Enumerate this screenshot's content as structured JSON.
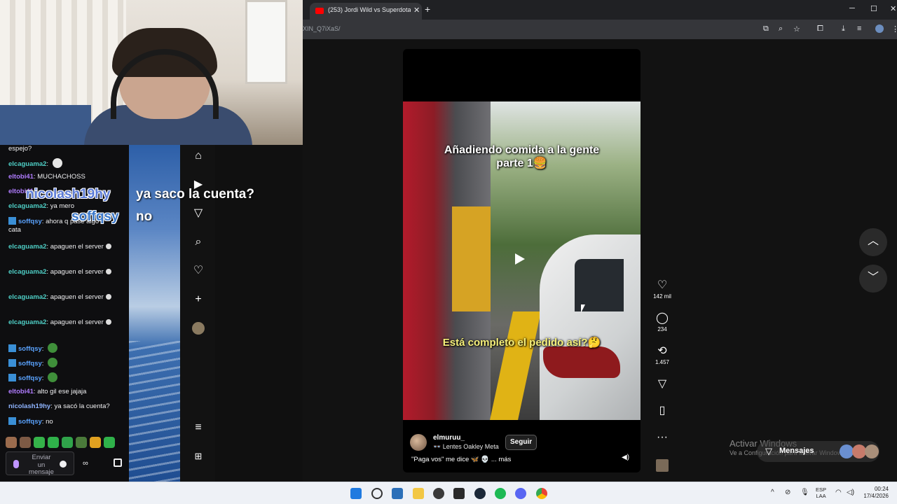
{
  "browser": {
    "tab_title": "(253) Jordi Wild vs Superdotad",
    "tab_close": "✕",
    "new_tab": "+",
    "url": "XIN_Q7iXaS/",
    "window_controls": {
      "minimize": "─",
      "maximize": "☐",
      "close": "✕"
    }
  },
  "chat": {
    "messages": [
      {
        "user": "",
        "text": "espejo?",
        "color": "#efeff1"
      },
      {
        "user": "elcaguama2",
        "text": "",
        "color": "#4ecdc4",
        "emote": "skull"
      },
      {
        "user": "eltobi41",
        "text": "MUCHACHOSS",
        "color": "#b07cff"
      },
      {
        "user": "eltobi41",
        "text": "",
        "color": "#b07cff"
      },
      {
        "user": "elcaguama2",
        "text": "ya mero",
        "color": "#4ecdc4"
      },
      {
        "user": "soffqsy",
        "text": "ahora q pase algo",
        "text2": "cata",
        "color": "#5aa3ff",
        "badge": true
      },
      {
        "user": "elcaguama2",
        "text": "apaguen el server",
        "color": "#4ecdc4"
      },
      {
        "user": "elcaguama2",
        "text": "apaguen el server",
        "color": "#4ecdc4"
      },
      {
        "user": "elcaguama2",
        "text": "apaguen el server",
        "color": "#4ecdc4"
      },
      {
        "user": "elcaguama2",
        "text": "apaguen el server",
        "color": "#4ecdc4"
      },
      {
        "user": "soffqsy",
        "text": "",
        "color": "#5aa3ff",
        "badge": true,
        "emote": "pepe"
      },
      {
        "user": "soffqsy",
        "text": "",
        "color": "#5aa3ff",
        "badge": true,
        "emote": "pepe"
      },
      {
        "user": "soffqsy",
        "text": "",
        "color": "#5aa3ff",
        "badge": true,
        "emote": "pepe"
      },
      {
        "user": "eltobi41",
        "text": "alto gil ese jajaja",
        "color": "#b07cff"
      },
      {
        "user": "nicolash19hy",
        "text": "ya sacó la cuenta?",
        "color": "#8fb4ff"
      },
      {
        "user": "soffqsy",
        "text": "no",
        "color": "#5aa3ff",
        "badge": true
      }
    ],
    "input_placeholder": "Enviar un mensaje",
    "bits": "∞"
  },
  "overlay": {
    "line1_user": "nicolash19hy",
    "line1_msg": "ya saco la cuenta?",
    "line2_user": "soffqsy",
    "line2_msg": "no"
  },
  "video": {
    "caption_top": "Añadiendo comida a la gente\nparte 1🍔",
    "caption_bottom": "Está completo el pedido así?🤔",
    "author": "elmuruu_",
    "music": "👓 Lentes Oakley Meta",
    "follow_label": "Seguir",
    "description": "\"Paga vos\" me dice 🦋 💀  ... más"
  },
  "actions": {
    "likes": "142 mil",
    "comments": "234",
    "reposts": "1.457"
  },
  "windows": {
    "activate_title": "Activar Windows",
    "activate_sub": "Ve a Configuración para activar Windows.",
    "messages_label": "Mensajes",
    "lang_top": "ESP",
    "lang_bottom": "LAA",
    "time": "00:24",
    "date": "17/4/2026"
  }
}
